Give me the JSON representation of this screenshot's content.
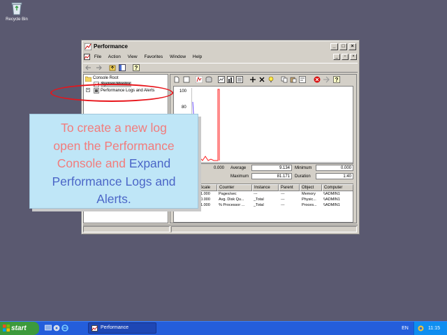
{
  "desktop": {
    "recycle_bin_label": "Recycle Bin"
  },
  "window": {
    "title": "Performance",
    "title_buttons": {
      "minimize": "_",
      "maximize": "□",
      "close": "×"
    }
  },
  "menubar": {
    "items": [
      "File",
      "Action",
      "View",
      "Favorites",
      "Window",
      "Help"
    ],
    "mdi_buttons": {
      "minimize": "_",
      "restore": "▫",
      "close": "×"
    }
  },
  "tree": {
    "root": "Console Root",
    "item_system_monitor": "System Monitor",
    "item_perf_logs": "Performance Logs and Alerts",
    "expander": "+"
  },
  "graph": {
    "y_ticks": [
      "100",
      "80"
    ],
    "y_max": 100
  },
  "stats": {
    "last_value": "0.000",
    "average_label": "Average",
    "average": "9.134",
    "minimum_label": "Minimum",
    "minimum": "0.000",
    "maximum_label": "Maximum",
    "maximum": "81.171",
    "duration_label": "Duration",
    "duration": "1:40"
  },
  "counters": {
    "columns": [
      "Scale",
      "Counter",
      "Instance",
      "Parent",
      "Object",
      "Computer"
    ],
    "rows": [
      {
        "scale": "1.000",
        "counter": "Pages/sec",
        "instance": "---",
        "parent": "---",
        "object": "Memory",
        "computer": "\\\\ADMIN1",
        "color": "#e8e0ff"
      },
      {
        "scale": "100.000",
        "counter": "Avg. Disk Qu...",
        "instance": "_Total",
        "parent": "---",
        "object": "Physic...",
        "computer": "\\\\ADMIN1",
        "color": "#7a7aff"
      },
      {
        "scale": "1.000",
        "counter": "% Processor ...",
        "instance": "_Total",
        "parent": "---",
        "object": "Proces...",
        "computer": "\\\\ADMIN1",
        "color": "#ff0000"
      }
    ]
  },
  "callout": {
    "line1": "To create a new log",
    "line2": "open the Performance",
    "line3_a": "Console and ",
    "line3_b": "Expand",
    "line4": "Performance Logs and",
    "line5": "Alerts."
  },
  "taskbar": {
    "start_label": "start",
    "task_label": "Performance",
    "language": "EN",
    "clock": "11:15"
  },
  "colors": {
    "desktop": "#5a5970",
    "taskbar": "#245edb",
    "callout_bg": "#bfe6f7",
    "callout_text": "#f27c7c",
    "callout_accent": "#4b66c7",
    "highlight_ellipse": "#e8141a"
  }
}
